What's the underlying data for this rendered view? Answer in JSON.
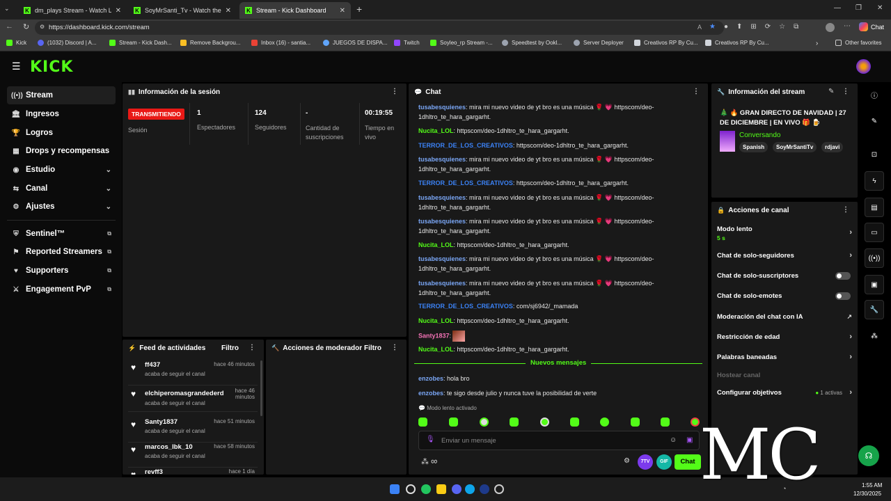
{
  "browser": {
    "tabs": [
      {
        "title": "dm_plays Stream - Watch Live on Kick"
      },
      {
        "title": "SoyMrSanti_Tv - Watch the VOD on Kick"
      },
      {
        "title": "Stream - Kick Dashboard"
      }
    ],
    "url": "https://dashboard.kick.com/stream",
    "copilot_label": "Chat",
    "bookmarks": [
      "Kick",
      "(1032) Discord | A...",
      "Stream - Kick Dash...",
      "Remove Backgrou...",
      "Inbox (16) - santia...",
      "JUEGOS DE DISPA...",
      "Twitch",
      "Soyleo_rp Stream -...",
      "Speedtest by Ookl...",
      "Server Deployer",
      "Creativos RP By Cu...",
      "Creativos RP By Cu..."
    ],
    "other_favorites": "Other favorites"
  },
  "app": {
    "logo": "KICK"
  },
  "sidebar": {
    "items": [
      {
        "label": "Stream",
        "icon": "broadcast-icon"
      },
      {
        "label": "Ingresos",
        "icon": "bank-icon"
      },
      {
        "label": "Logros",
        "icon": "trophy-icon"
      },
      {
        "label": "Drops y recompensas",
        "icon": "drops-icon"
      },
      {
        "label": "Estudio",
        "icon": "studio-icon"
      },
      {
        "label": "Canal",
        "icon": "channel-icon"
      },
      {
        "label": "Ajustes",
        "icon": "gear-icon"
      },
      {
        "label": "Sentinel™",
        "icon": "shield-icon"
      },
      {
        "label": "Reported Streamers",
        "icon": "flag-icon"
      },
      {
        "label": "Supporters",
        "icon": "heart-icon"
      },
      {
        "label": "Engagement PvP",
        "icon": "swords-icon"
      }
    ]
  },
  "session": {
    "title": "Información de la sesión",
    "status": "TRANSMITIENDO",
    "status_label": "Sesión",
    "stats": [
      {
        "value": "1",
        "label": "Espectadores"
      },
      {
        "value": "124",
        "label": "Seguidores"
      },
      {
        "value": "-",
        "label": "Cantidad de suscripciones"
      },
      {
        "value": "00:19:55",
        "label": "Tiempo en vivo"
      }
    ]
  },
  "feed": {
    "title": "Feed de actividades",
    "filter": "Filtro",
    "items": [
      {
        "name": "ff437",
        "status": "acaba de seguir el canal",
        "time": "hace 46 minutos"
      },
      {
        "name": "elchiperomasgrandederd",
        "status": "acaba de seguir el canal",
        "time": "hace 46 minutos"
      },
      {
        "name": "Santy1837",
        "status": "acaba de seguir el canal",
        "time": "hace 51 minutos"
      },
      {
        "name": "marcos_lbk_10",
        "status": "acaba de seguir el canal",
        "time": "hace 58 minutos"
      },
      {
        "name": "revff3",
        "status": "",
        "time": "hace 1 día"
      }
    ]
  },
  "mod": {
    "title": "Acciones de moderador",
    "filter": "Filtro"
  },
  "chat": {
    "title": "Chat",
    "messages": [
      {
        "user": "tusabesquienes",
        "text": ": mira mi nuevo video de yt bro es una música 🌹 💗 httpscom/deo-1dhltro_te_hara_gargarht.",
        "cls": "u1"
      },
      {
        "user": "Nucita_LOL",
        "text": ": httpscom/deo-1dhltro_te_hara_gargarht.",
        "cls": "u2"
      },
      {
        "user": "TERROR_DE_LOS_CREATIVOS",
        "text": ": httpscom/deo-1dhltro_te_hara_gargarht.",
        "cls": "u3"
      },
      {
        "user": "tusabesquienes",
        "text": ": mira mi nuevo video de yt bro es una música 🌹 💗 httpscom/deo-1dhltro_te_hara_gargarht.",
        "cls": "u1"
      },
      {
        "user": "TERROR_DE_LOS_CREATIVOS",
        "text": ": httpscom/deo-1dhltro_te_hara_gargarht.",
        "cls": "u3"
      },
      {
        "user": "tusabesquienes",
        "text": ": mira mi nuevo video de yt bro es una música 🌹 💗 httpscom/deo-1dhltro_te_hara_gargarht.",
        "cls": "u1"
      },
      {
        "user": "tusabesquienes",
        "text": ": mira mi nuevo video de yt bro es una música 🌹 💗 httpscom/deo-1dhltro_te_hara_gargarht.",
        "cls": "u1"
      },
      {
        "user": "Nucita_LOL",
        "text": ": httpscom/deo-1dhltro_te_hara_gargarht.",
        "cls": "u2"
      },
      {
        "user": "tusabesquienes",
        "text": ": mira mi nuevo video de yt bro es una música 🌹 💗 httpscom/deo-1dhltro_te_hara_gargarht.",
        "cls": "u1"
      },
      {
        "user": "tusabesquienes",
        "text": ": mira mi nuevo video de yt bro es una música 🌹 💗 httpscom/deo-1dhltro_te_hara_gargarht.",
        "cls": "u1"
      },
      {
        "user": "TERROR_DE_LOS_CREATIVOS",
        "text": ": com/sj6942/_mamada",
        "cls": "u3"
      },
      {
        "user": "Nucita_LOL",
        "text": ": httpscom/deo-1dhltro_te_hara_gargarht.",
        "cls": "u2"
      },
      {
        "user": "Santy1837",
        "text": ":",
        "cls": "u4"
      },
      {
        "user": "Nucita_LOL",
        "text": ": httpscom/deo-1dhltro_te_hara_gargarht.",
        "cls": "u2"
      }
    ],
    "new_messages": "Nuevos mensajes",
    "new": [
      {
        "user": "enzobes",
        "text": ": hola bro"
      },
      {
        "user": "enzobes",
        "text": ": te sigo desde julio y nunca tuve la posibilidad de verte"
      }
    ],
    "slow_mode_notice": "Modo lento activado",
    "input_placeholder": "Enviar un mensaje",
    "btn_7tv": "7TV",
    "btn_gif": "GIF",
    "send": "Chat"
  },
  "stream_info": {
    "title": "Información del stream",
    "stream_title": "🎄 🔥 GRAN DIRECTO DE NAVIDAD | 27 DE DICIEMBRE | EN VIVO 🎁 🍺",
    "category": "Conversando",
    "tags": [
      "Spanish",
      "SoyMrSantiTv",
      "rdjavi"
    ]
  },
  "channel_actions": {
    "title": "Acciones de canal",
    "items": [
      {
        "label": "Modo lento",
        "sub": "5 s",
        "ctrl": "chevron"
      },
      {
        "label": "Chat de solo-seguidores",
        "ctrl": "chevron"
      },
      {
        "label": "Chat de solo-suscriptores",
        "ctrl": "toggle"
      },
      {
        "label": "Chat de solo-emotes",
        "ctrl": "toggle"
      },
      {
        "label": "Moderación del chat con IA",
        "ctrl": "external"
      },
      {
        "label": "Restricción de edad",
        "ctrl": "chevron"
      },
      {
        "label": "Palabras baneadas",
        "ctrl": "chevron"
      },
      {
        "label": "Hostear canal",
        "ctrl": "none"
      },
      {
        "label": "Configurar objetivos",
        "badge": "1 activas",
        "ctrl": "chevron"
      }
    ]
  },
  "overlay": {
    "watermark": "MC"
  },
  "taskbar": {
    "time": "1:55 AM",
    "date": "12/30/2025"
  },
  "colors": {
    "accent": "#53fc18",
    "live": "#e91916"
  }
}
